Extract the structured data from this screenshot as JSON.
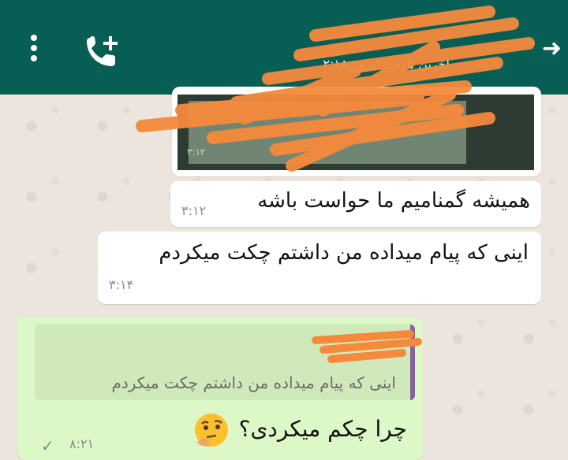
{
  "header": {
    "last_seen": "آخرین بازدید امروز ۲:۱۸",
    "icons": [
      "more-vert-icon",
      "add-call-icon",
      "back-arrow-icon"
    ]
  },
  "media_message": {
    "time": "۳:۱۲"
  },
  "messages": [
    {
      "direction": "incoming",
      "text": "همیشه گمنامیم ما حواست باشه",
      "time": "۳:۱۲"
    },
    {
      "direction": "incoming",
      "text": "اینی که پیام میداده من داشتم چکت میکردم",
      "time": "۳:۱۴"
    },
    {
      "direction": "outgoing",
      "quoted": "اینی که پیام میداده من داشتم چکت میکردم",
      "text": "چرا چکم میکردی؟",
      "emoji": "thinking-face",
      "time": "۸:۲۱",
      "status": "sent-check"
    }
  ],
  "colors": {
    "header": "#075e54",
    "incoming_bubble": "#ffffff",
    "outgoing_bubble": "#dcf8c6",
    "quote_bar": "#8e5fa8",
    "redaction": "#f58a3c"
  }
}
